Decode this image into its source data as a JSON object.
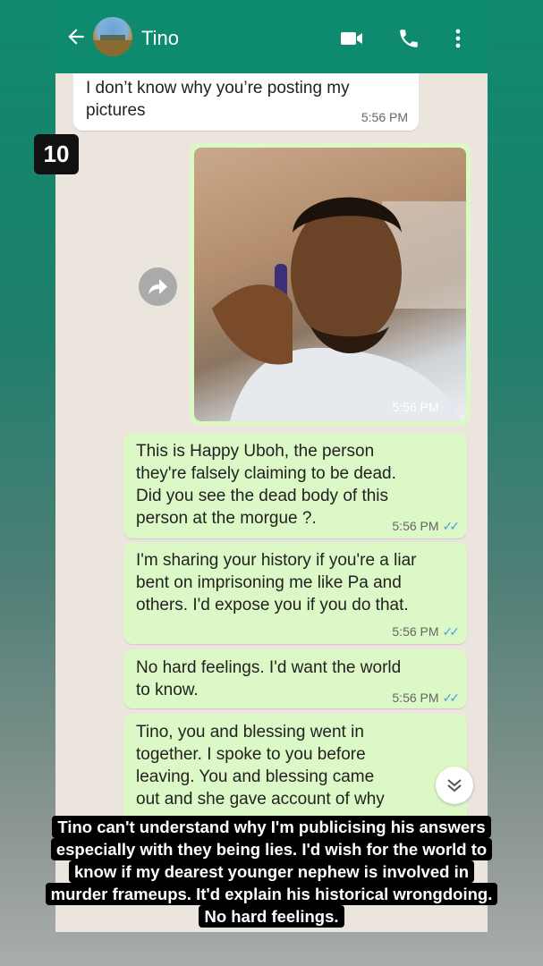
{
  "header": {
    "contact_name": "Tino",
    "icons": [
      "back-arrow-icon",
      "contact-avatar",
      "video-call-icon",
      "phone-icon",
      "more-vert-icon"
    ]
  },
  "badge": {
    "number": "10"
  },
  "messages": [
    {
      "direction": "incoming",
      "text": "I don’t know why you’re posting my\npictures",
      "time": "5:56 PM"
    },
    {
      "direction": "outgoing",
      "type": "image",
      "time": "5:56 PM"
    },
    {
      "direction": "outgoing",
      "text": "This is Happy Uboh, the person\nthey're falsely claiming to be dead.\nDid you see the dead body of this\nperson at the morgue ?.",
      "time": "5:56 PM"
    },
    {
      "direction": "outgoing",
      "text": "I'm sharing your history if you're a liar\nbent on imprisoning me like Pa and\nothers.  I'd expose you if you do that.",
      "time": "5:56 PM"
    },
    {
      "direction": "outgoing",
      "text": "No hard feelings. I'd want the world\nto know.",
      "time": "5:56 PM"
    },
    {
      "direction": "outgoing",
      "text": "Tino, you and blessing went in\ntogether. I spoke to you before\nleaving. You and blessing came\nout and she gave account of why"
    }
  ],
  "caption": [
    "Tino can't understand why I'm publicising his answers",
    "especially with they being lies. I'd wish for the world to",
    "know if my dearest younger nephew is involved in",
    "murder frameups. It'd explain his historical wrongdoing.",
    "No hard feelings."
  ],
  "colors": {
    "header": "#0e8a6e",
    "outgoing": "#dcf8c6",
    "incoming": "#ffffff",
    "chat_bg": "#ece5dd",
    "read_tick": "#4aa3e0"
  }
}
